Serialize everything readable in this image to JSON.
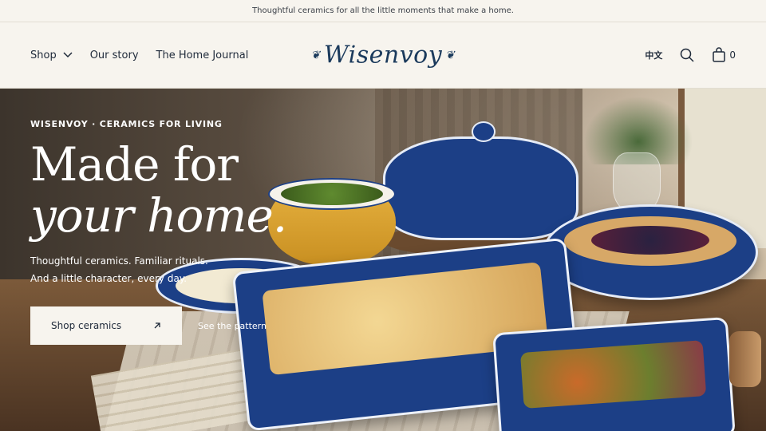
{
  "announcement": "Thoughtful ceramics for all the little moments that make a home.",
  "nav": {
    "items": [
      {
        "label": "Shop",
        "has_dropdown": true
      },
      {
        "label": "Our story"
      },
      {
        "label": "The Home Journal"
      }
    ]
  },
  "logo": {
    "text": "Wisenvoy"
  },
  "utils": {
    "language": "中文",
    "cart_count": "0",
    "icons": [
      "search-icon",
      "cart-icon"
    ]
  },
  "hero": {
    "eyebrow": "WISENVOY · CERAMICS FOR LIVING",
    "headline_line1": "Made for",
    "headline_line2": "your home.",
    "sub_line1": "Thoughtful ceramics. Familiar rituals.",
    "sub_line2": "And a little character, every day.",
    "cta_label": "Shop ceramics",
    "cta_icon": "arrow-up-right-icon",
    "secondary_link": "See the pattern"
  },
  "colors": {
    "brand_blue": "#1c3f86",
    "cream": "#f7f4ee",
    "ink": "#1f2a3a"
  }
}
